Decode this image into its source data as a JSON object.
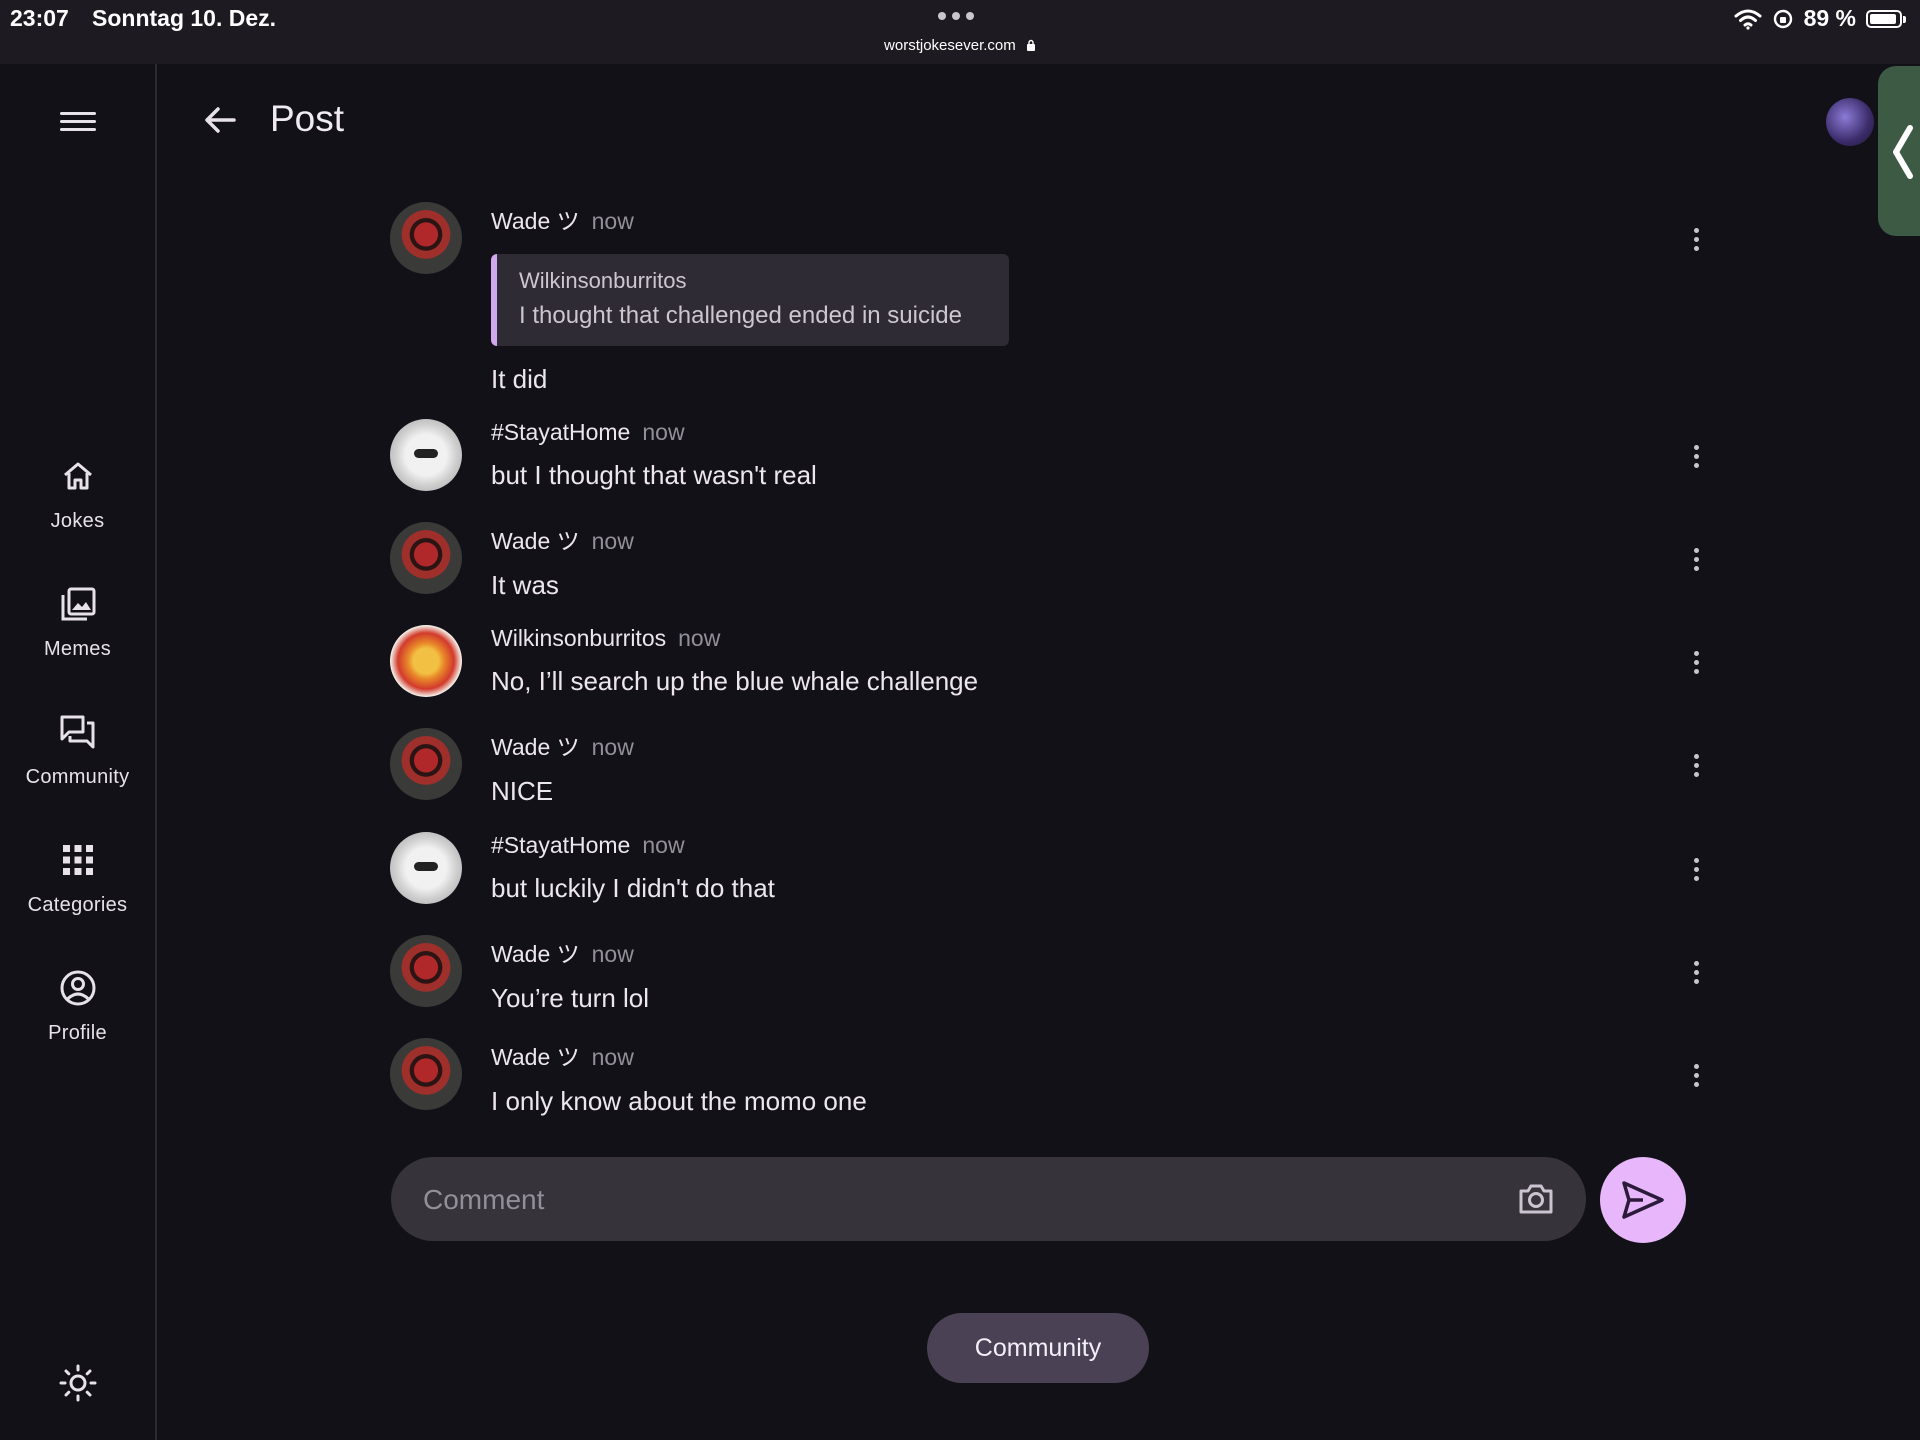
{
  "status_bar": {
    "time": "23:07",
    "date": "Sonntag 10. Dez.",
    "url": "worstjokesever.com",
    "battery": "89 %"
  },
  "sidebar": {
    "items": [
      {
        "label": "Jokes",
        "icon": "home-icon"
      },
      {
        "label": "Memes",
        "icon": "images-icon"
      },
      {
        "label": "Community",
        "icon": "forum-icon"
      },
      {
        "label": "Categories",
        "icon": "grid-icon"
      },
      {
        "label": "Profile",
        "icon": "account-circle-icon"
      }
    ]
  },
  "header": {
    "title": "Post"
  },
  "comments": [
    {
      "author": "Wade ツ",
      "time": "now",
      "avatar": "wade",
      "quote": {
        "author": "Wilkinsonburritos",
        "text": "I thought that challenged ended in suicide"
      },
      "text": "It did"
    },
    {
      "author": "#StayatHome",
      "time": "now",
      "avatar": "stayathome",
      "text": "but I thought that wasn't real"
    },
    {
      "author": "Wade ツ",
      "time": "now",
      "avatar": "wade",
      "text": "It was"
    },
    {
      "author": "Wilkinsonburritos",
      "time": "now",
      "avatar": "wilkinson",
      "text": "No, I’ll search up the blue whale challenge"
    },
    {
      "author": "Wade ツ",
      "time": "now",
      "avatar": "wade",
      "text": "NICE"
    },
    {
      "author": "#StayatHome",
      "time": "now",
      "avatar": "stayathome",
      "text": "but luckily I didn't do that"
    },
    {
      "author": "Wade ツ",
      "time": "now",
      "avatar": "wade",
      "text": "You’re turn lol"
    },
    {
      "author": "Wade ツ",
      "time": "now",
      "avatar": "wade",
      "text": "I only know about the momo one"
    }
  ],
  "comment_box": {
    "placeholder": "Comment",
    "value": ""
  },
  "footer": {
    "community_button": "Community"
  },
  "colors": {
    "background": "#131118",
    "accent": "#e7b6fb",
    "quote_bar": "#cfa8ee",
    "input_bg": "#36333b",
    "pill_bg": "#4a4254"
  }
}
